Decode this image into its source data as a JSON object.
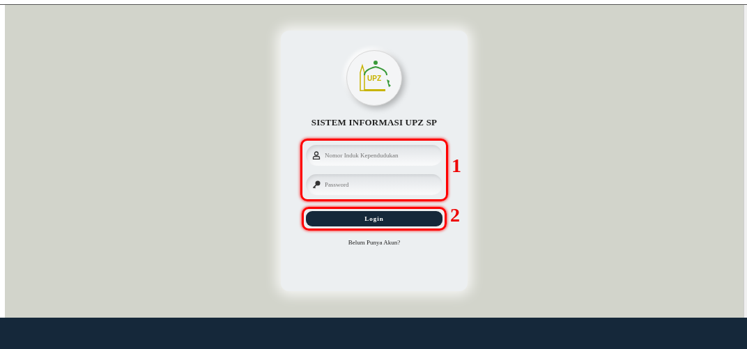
{
  "logo": {
    "text": "UPZ"
  },
  "title": "SISTEM INFORMASI UPZ SP",
  "fields": [
    {
      "kind": "user",
      "placeholder": "Nomor Induk Kependudukan"
    },
    {
      "kind": "password",
      "placeholder": "Password"
    }
  ],
  "login_button": "Login",
  "register_link": "Belum Punya Akun?",
  "annotations": [
    "1",
    "2"
  ]
}
